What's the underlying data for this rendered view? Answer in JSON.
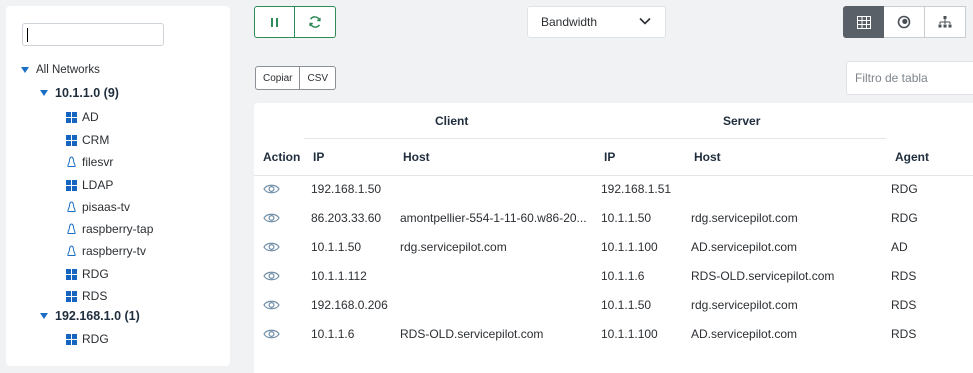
{
  "sidebar": {
    "search_value": "",
    "tree": {
      "root": "All Networks",
      "networks": [
        {
          "label": "10.1.1.0 (9)",
          "children": [
            {
              "label": "AD",
              "icon": "windows-icon"
            },
            {
              "label": "CRM",
              "icon": "windows-icon"
            },
            {
              "label": "filesvr",
              "icon": "linux-icon"
            },
            {
              "label": "LDAP",
              "icon": "windows-icon"
            },
            {
              "label": "pisaas-tv",
              "icon": "linux-icon"
            },
            {
              "label": "raspberry-tap",
              "icon": "linux-icon"
            },
            {
              "label": "raspberry-tv",
              "icon": "linux-icon"
            },
            {
              "label": "RDG",
              "icon": "windows-icon"
            },
            {
              "label": "RDS",
              "icon": "windows-icon"
            }
          ]
        },
        {
          "label": "192.168.1.0 (1)",
          "children": [
            {
              "label": "RDG",
              "icon": "windows-icon"
            }
          ]
        }
      ]
    }
  },
  "toolbar": {
    "metric_select": "Bandwidth",
    "export": {
      "copy_label": "Copiar",
      "csv_label": "CSV"
    },
    "filter_placeholder": "Filtro de tabla"
  },
  "colors": {
    "accent_green": "#2e8b57",
    "tree_blue": "#1a6fc2",
    "active_view": "#5a6068"
  },
  "table": {
    "group_headers": {
      "client": "Client",
      "server": "Server"
    },
    "columns": {
      "action": "Action",
      "client_ip": "IP",
      "client_host": "Host",
      "server_ip": "IP",
      "server_host": "Host",
      "agent": "Agent"
    },
    "rows": [
      {
        "client_ip": "192.168.1.50",
        "client_host": "",
        "server_ip": "192.168.1.51",
        "server_host": "",
        "agent": "RDG"
      },
      {
        "client_ip": "86.203.33.60",
        "client_host": "amontpellier-554-1-11-60.w86-20...",
        "server_ip": "10.1.1.50",
        "server_host": "rdg.servicepilot.com",
        "agent": "RDG"
      },
      {
        "client_ip": "10.1.1.50",
        "client_host": "rdg.servicepilot.com",
        "server_ip": "10.1.1.100",
        "server_host": "AD.servicepilot.com",
        "agent": "AD"
      },
      {
        "client_ip": "10.1.1.112",
        "client_host": "",
        "server_ip": "10.1.1.6",
        "server_host": "RDS-OLD.servicepilot.com",
        "agent": "RDS"
      },
      {
        "client_ip": "192.168.0.206",
        "client_host": "",
        "server_ip": "10.1.1.50",
        "server_host": "rdg.servicepilot.com",
        "agent": "RDS"
      },
      {
        "client_ip": "10.1.1.6",
        "client_host": "RDS-OLD.servicepilot.com",
        "server_ip": "10.1.1.100",
        "server_host": "AD.servicepilot.com",
        "agent": "RDS"
      }
    ]
  }
}
